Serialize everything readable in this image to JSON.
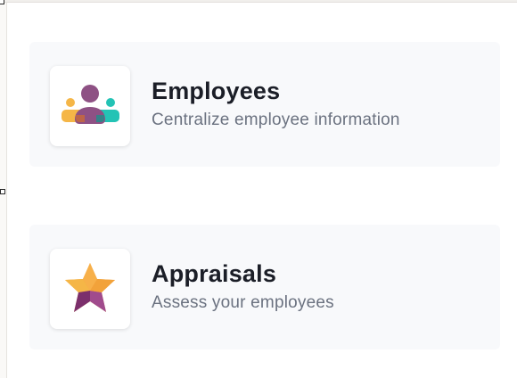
{
  "apps": [
    {
      "title": "Employees",
      "subtitle": "Centralize employee information",
      "icon": "employees-icon",
      "colors": {
        "primary": "#8e5184",
        "left": "#f5b647",
        "right": "#23c3b5"
      }
    },
    {
      "title": "Appraisals",
      "subtitle": "Assess your employees",
      "icon": "appraisals-star-icon",
      "colors": {
        "top": "#f7a43a",
        "left": "#7b2f6c",
        "right": "#a04b8d",
        "center": "#f2c14c"
      }
    }
  ]
}
